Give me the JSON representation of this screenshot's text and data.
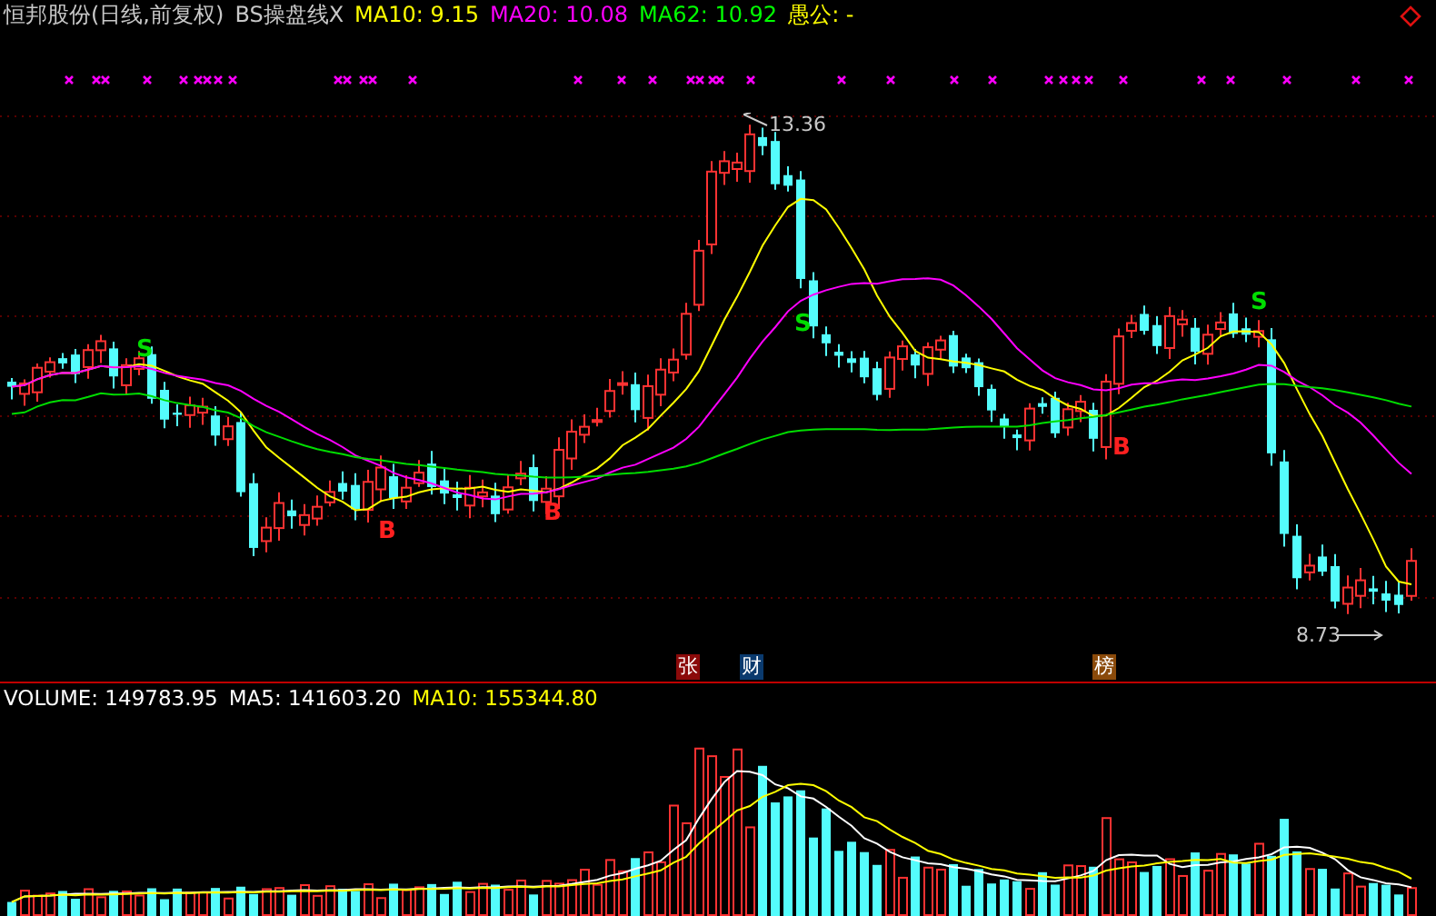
{
  "header": {
    "title": "恒邦股份(日线,前复权)",
    "indicator": "BS操盘线X",
    "values": [
      {
        "label": "MA10: 9.15",
        "color": "#ffff00"
      },
      {
        "label": "MA20: 10.08",
        "color": "#ff00ff"
      },
      {
        "label": "MA62: 10.92",
        "color": "#00ff00"
      },
      {
        "label": "愚公: -",
        "color": "#ffff00"
      }
    ]
  },
  "chart": {
    "signals": [
      {
        "kind": "sell",
        "label": "S"
      },
      {
        "kind": "buy",
        "label": "B"
      },
      {
        "kind": "buy",
        "label": "B"
      },
      {
        "kind": "sell",
        "label": "S"
      },
      {
        "kind": "buy",
        "label": "B"
      },
      {
        "kind": "sell",
        "label": "S"
      }
    ],
    "high_label": "13.36",
    "low_label": "8.73"
  },
  "badges": [
    {
      "label": "张",
      "color": "#8b0a0a"
    },
    {
      "label": "财",
      "color": "#0a3a6e"
    },
    {
      "label": "榜",
      "color": "#8a4a0a"
    }
  ],
  "volume_header": [
    {
      "label": "VOLUME: 149783.95",
      "color": "#ffffff"
    },
    {
      "label": "MA5: 141603.20",
      "color": "#ffffff"
    },
    {
      "label": "MA10: 155344.80",
      "color": "#ffff00"
    }
  ]
}
